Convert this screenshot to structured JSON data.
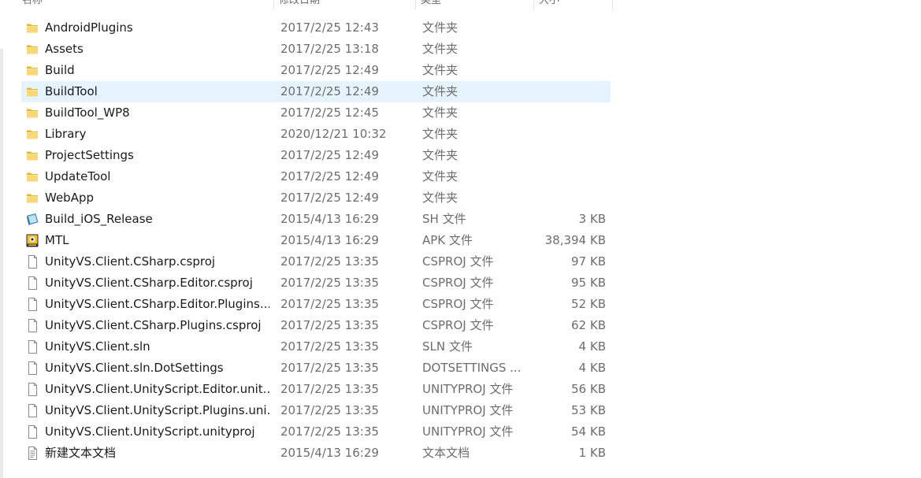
{
  "columns": {
    "name": "名称",
    "date": "修改日期",
    "type": "类型",
    "size": "大小"
  },
  "files": [
    {
      "name": "AndroidPlugins",
      "date": "2017/2/25 12:43",
      "type": "文件夹",
      "size": "",
      "icon": "folder-icon",
      "selected": false
    },
    {
      "name": "Assets",
      "date": "2017/2/25 13:18",
      "type": "文件夹",
      "size": "",
      "icon": "folder-icon",
      "selected": false
    },
    {
      "name": "Build",
      "date": "2017/2/25 12:49",
      "type": "文件夹",
      "size": "",
      "icon": "folder-icon",
      "selected": false
    },
    {
      "name": "BuildTool",
      "date": "2017/2/25 12:49",
      "type": "文件夹",
      "size": "",
      "icon": "folder-icon",
      "selected": true
    },
    {
      "name": "BuildTool_WP8",
      "date": "2017/2/25 12:45",
      "type": "文件夹",
      "size": "",
      "icon": "folder-icon",
      "selected": false
    },
    {
      "name": "Library",
      "date": "2020/12/21 10:32",
      "type": "文件夹",
      "size": "",
      "icon": "folder-icon",
      "selected": false
    },
    {
      "name": "ProjectSettings",
      "date": "2017/2/25 12:49",
      "type": "文件夹",
      "size": "",
      "icon": "folder-icon",
      "selected": false
    },
    {
      "name": "UpdateTool",
      "date": "2017/2/25 12:49",
      "type": "文件夹",
      "size": "",
      "icon": "folder-icon",
      "selected": false
    },
    {
      "name": "WebApp",
      "date": "2017/2/25 12:49",
      "type": "文件夹",
      "size": "",
      "icon": "folder-icon",
      "selected": false
    },
    {
      "name": "Build_iOS_Release",
      "date": "2015/4/13 16:29",
      "type": "SH 文件",
      "size": "3 KB",
      "icon": "shell-script-icon",
      "selected": false
    },
    {
      "name": "MTL",
      "date": "2015/4/13 16:29",
      "type": "APK 文件",
      "size": "38,394 KB",
      "icon": "apk-icon",
      "selected": false
    },
    {
      "name": "UnityVS.Client.CSharp.csproj",
      "date": "2017/2/25 13:35",
      "type": "CSPROJ 文件",
      "size": "97 KB",
      "icon": "file-icon",
      "selected": false
    },
    {
      "name": "UnityVS.Client.CSharp.Editor.csproj",
      "date": "2017/2/25 13:35",
      "type": "CSPROJ 文件",
      "size": "95 KB",
      "icon": "file-icon",
      "selected": false
    },
    {
      "name": "UnityVS.Client.CSharp.Editor.Plugins....",
      "date": "2017/2/25 13:35",
      "type": "CSPROJ 文件",
      "size": "52 KB",
      "icon": "file-icon",
      "selected": false
    },
    {
      "name": "UnityVS.Client.CSharp.Plugins.csproj",
      "date": "2017/2/25 13:35",
      "type": "CSPROJ 文件",
      "size": "62 KB",
      "icon": "file-icon",
      "selected": false
    },
    {
      "name": "UnityVS.Client.sln",
      "date": "2017/2/25 13:35",
      "type": "SLN 文件",
      "size": "4 KB",
      "icon": "file-icon",
      "selected": false
    },
    {
      "name": "UnityVS.Client.sln.DotSettings",
      "date": "2017/2/25 13:35",
      "type": "DOTSETTINGS ...",
      "size": "4 KB",
      "icon": "file-icon",
      "selected": false
    },
    {
      "name": "UnityVS.Client.UnityScript.Editor.unit...",
      "date": "2017/2/25 13:35",
      "type": "UNITYPROJ 文件",
      "size": "56 KB",
      "icon": "file-icon",
      "selected": false
    },
    {
      "name": "UnityVS.Client.UnityScript.Plugins.uni...",
      "date": "2017/2/25 13:35",
      "type": "UNITYPROJ 文件",
      "size": "53 KB",
      "icon": "file-icon",
      "selected": false
    },
    {
      "name": "UnityVS.Client.UnityScript.unityproj",
      "date": "2017/2/25 13:35",
      "type": "UNITYPROJ 文件",
      "size": "54 KB",
      "icon": "file-icon",
      "selected": false
    },
    {
      "name": "新建文本文档",
      "date": "2015/4/13 16:29",
      "type": "文本文档",
      "size": "1 KB",
      "icon": "text-document-icon",
      "selected": false
    }
  ],
  "colors": {
    "selection": "#e5f3ff",
    "folder": "#f4c955",
    "secondary_text": "#6d6d6d"
  }
}
